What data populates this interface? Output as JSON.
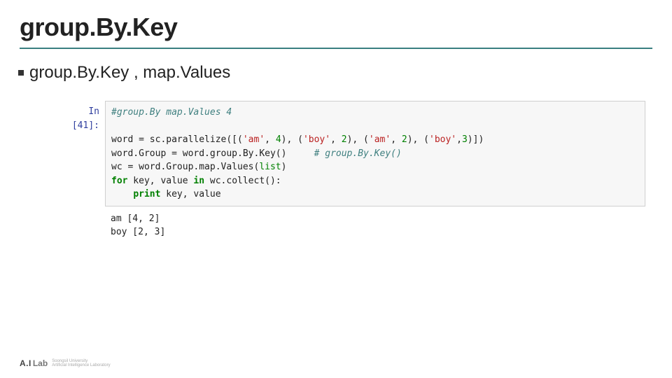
{
  "title": "group.By.Key",
  "bullet": "group.By.Key , map.Values",
  "notebook": {
    "prompt_label": "In [41]:",
    "code": {
      "comment1": "#group.By map.Values 4",
      "l1a": "word = sc.parallelize([(",
      "l1s1": "'am'",
      "l1p1": ", ",
      "l1n1": "4",
      "l1p2": "), (",
      "l1s2": "'boy'",
      "l1p3": ", ",
      "l1n2": "2",
      "l1p4": "), (",
      "l1s3": "'am'",
      "l1p5": ", ",
      "l1n3": "2",
      "l1p6": "), (",
      "l1s4": "'boy'",
      "l1p7": ",",
      "l1n4": "3",
      "l1p8": ")])",
      "l2a": "word.Group = word.group.By.Key()     ",
      "l2c": "# group.By.Key()",
      "l3a": "wc = word.Group.map.Values(",
      "l3b": "list",
      "l3c": ")",
      "l4a": "for",
      "l4b": " key, value ",
      "l4c": "in",
      "l4d": " wc.collect():",
      "l5a": "    ",
      "l5b": "print",
      "l5c": " key, value"
    },
    "output": "am [4, 2]\nboy [2, 3]"
  },
  "footer": {
    "ai": "A.I",
    "lab": "Lab",
    "sub1": "Soongsil University",
    "sub2": "Artificial Intelligence Laboratory"
  }
}
